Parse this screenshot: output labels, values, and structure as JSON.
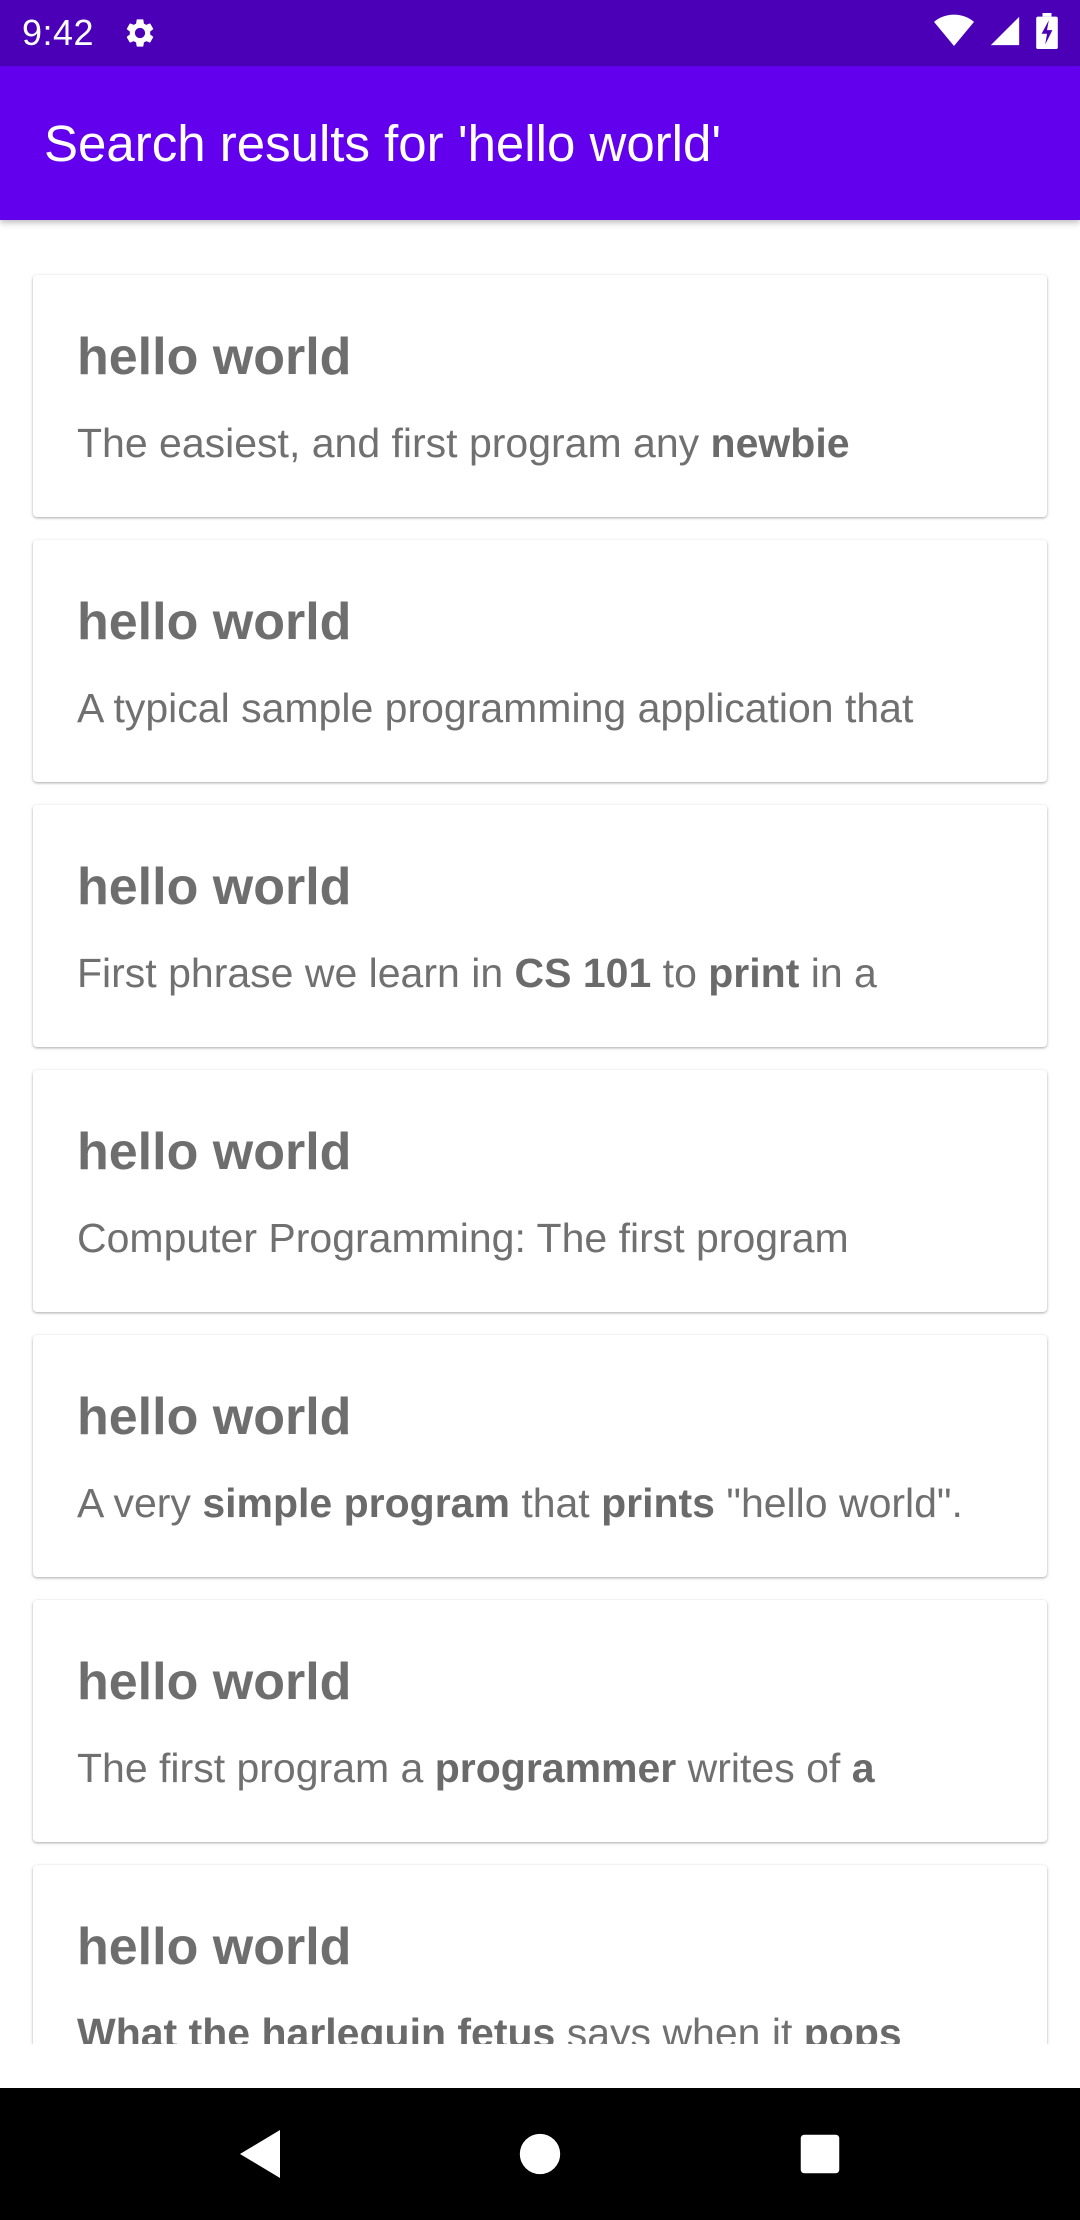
{
  "status_bar": {
    "time": "9:42",
    "icons": [
      "gear-icon",
      "wifi-icon",
      "cell-signal-icon",
      "battery-charging-icon"
    ]
  },
  "app_bar": {
    "title": "Search results for 'hello world'"
  },
  "results": [
    {
      "title": "hello world",
      "desc": [
        {
          "text": "The easiest, and first program any ",
          "bold": false
        },
        {
          "text": "newbie",
          "bold": true
        }
      ]
    },
    {
      "title": "hello world",
      "desc": [
        {
          "text": "A typical sample programming application that",
          "bold": false
        }
      ]
    },
    {
      "title": "hello world",
      "desc": [
        {
          "text": "First phrase we learn in ",
          "bold": false
        },
        {
          "text": "CS 101",
          "bold": true
        },
        {
          "text": " to ",
          "bold": false
        },
        {
          "text": "print",
          "bold": true
        },
        {
          "text": " in a",
          "bold": false
        }
      ]
    },
    {
      "title": "hello world",
      "desc": [
        {
          "text": "Computer Programming: The first program",
          "bold": false
        }
      ]
    },
    {
      "title": "hello world",
      "desc": [
        {
          "text": "A very ",
          "bold": false
        },
        {
          "text": "simple program",
          "bold": true
        },
        {
          "text": " that ",
          "bold": false
        },
        {
          "text": "prints",
          "bold": true
        },
        {
          "text": " \"hello world\".",
          "bold": false
        }
      ]
    },
    {
      "title": "hello world",
      "desc": [
        {
          "text": "The first program a ",
          "bold": false
        },
        {
          "text": "programmer",
          "bold": true
        },
        {
          "text": " writes of ",
          "bold": false
        },
        {
          "text": "a",
          "bold": true
        }
      ]
    },
    {
      "title": "hello world",
      "desc": [
        {
          "text": "What the harlequin fetus",
          "bold": true
        },
        {
          "text": " says when it ",
          "bold": false
        },
        {
          "text": "pops",
          "bold": true
        }
      ]
    }
  ],
  "nav_bar": {
    "buttons": [
      "back-icon",
      "home-icon",
      "recents-icon"
    ]
  },
  "colors": {
    "status_bar": "#4b00b8",
    "app_bar": "#6200ee",
    "card_text": "#707070"
  }
}
